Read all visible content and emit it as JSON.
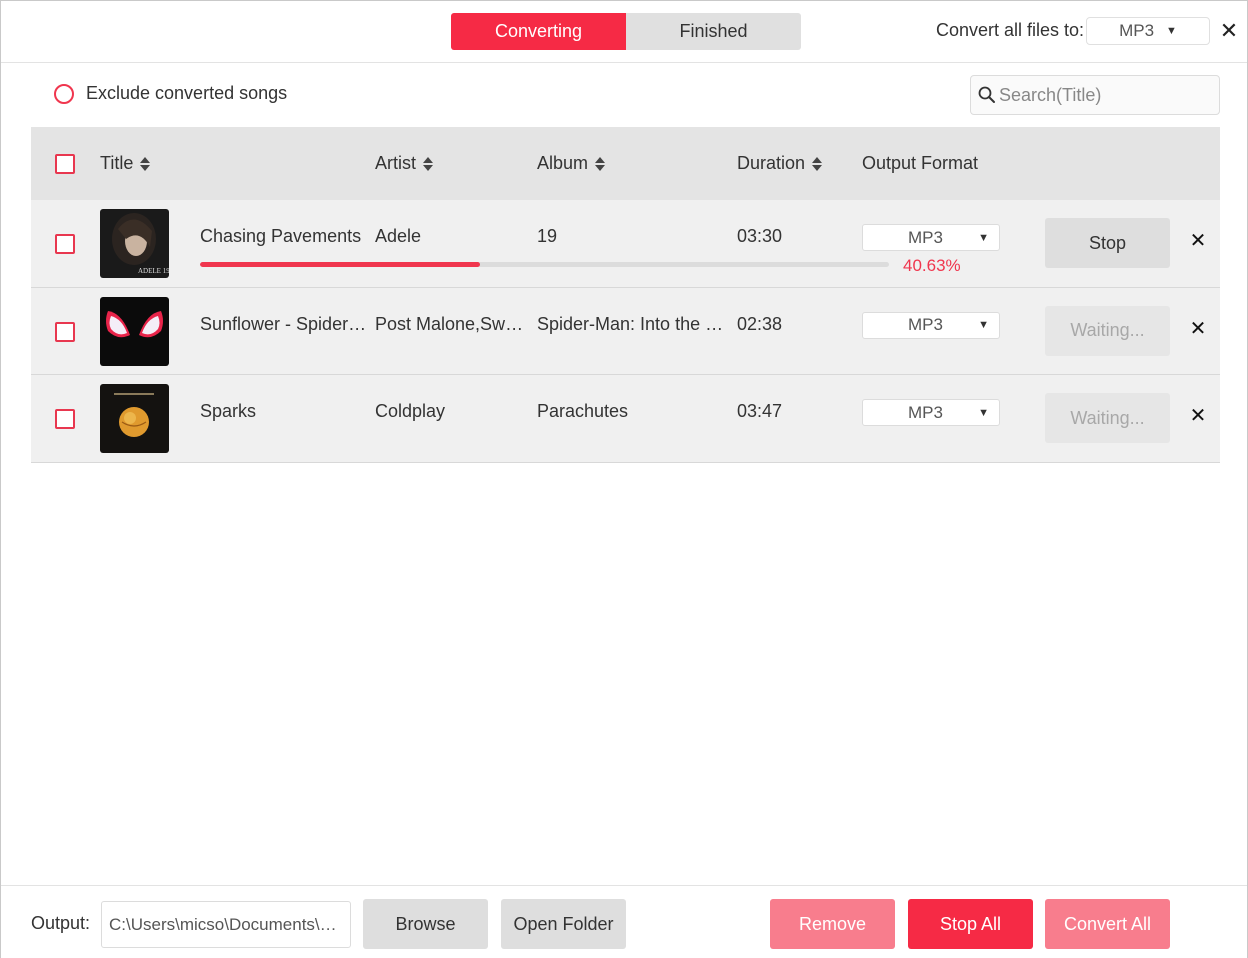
{
  "header": {
    "tabs": [
      {
        "label": "Converting",
        "active": true
      },
      {
        "label": "Finished",
        "active": false
      }
    ],
    "convert_all_label": "Convert all files to:",
    "convert_all_format": "MP3",
    "close_symbol": "✕"
  },
  "filter": {
    "exclude_label": "Exclude converted songs",
    "search_placeholder": "Search(Title)"
  },
  "table": {
    "columns": {
      "title": "Title",
      "artist": "Artist",
      "album": "Album",
      "duration": "Duration",
      "output_format": "Output Format"
    },
    "rows": [
      {
        "title": "Chasing Pavements",
        "artist": "Adele",
        "album": "19",
        "duration": "03:30",
        "format": "MP3",
        "progress_percent": 40.63,
        "percent_text": "40.63%",
        "action": "Stop",
        "cover_text": "ADELE 19"
      },
      {
        "title": "Sunflower - Spider-…",
        "artist": "Post Malone,Swa…",
        "album": "Spider-Man: Into the S…",
        "duration": "02:38",
        "format": "MP3",
        "action": "Waiting..."
      },
      {
        "title": "Sparks",
        "artist": "Coldplay",
        "album": "Parachutes",
        "duration": "03:47",
        "format": "MP3",
        "action": "Waiting..."
      }
    ],
    "row_close_symbol": "✕"
  },
  "footer": {
    "output_label": "Output:",
    "output_path": "C:\\Users\\micso\\Documents\\…",
    "browse_label": "Browse",
    "open_folder_label": "Open Folder",
    "remove_label": "Remove",
    "stop_all_label": "Stop All",
    "convert_all_label": "Convert All"
  },
  "colors": {
    "accent": "#f62a45",
    "accent_light": "#f87d8d",
    "table_header_bg": "#e4e4e4",
    "row_bg": "#f0f0f0"
  },
  "icons": [
    "search-icon",
    "sort-icon",
    "caret-down-icon",
    "close-icon"
  ]
}
